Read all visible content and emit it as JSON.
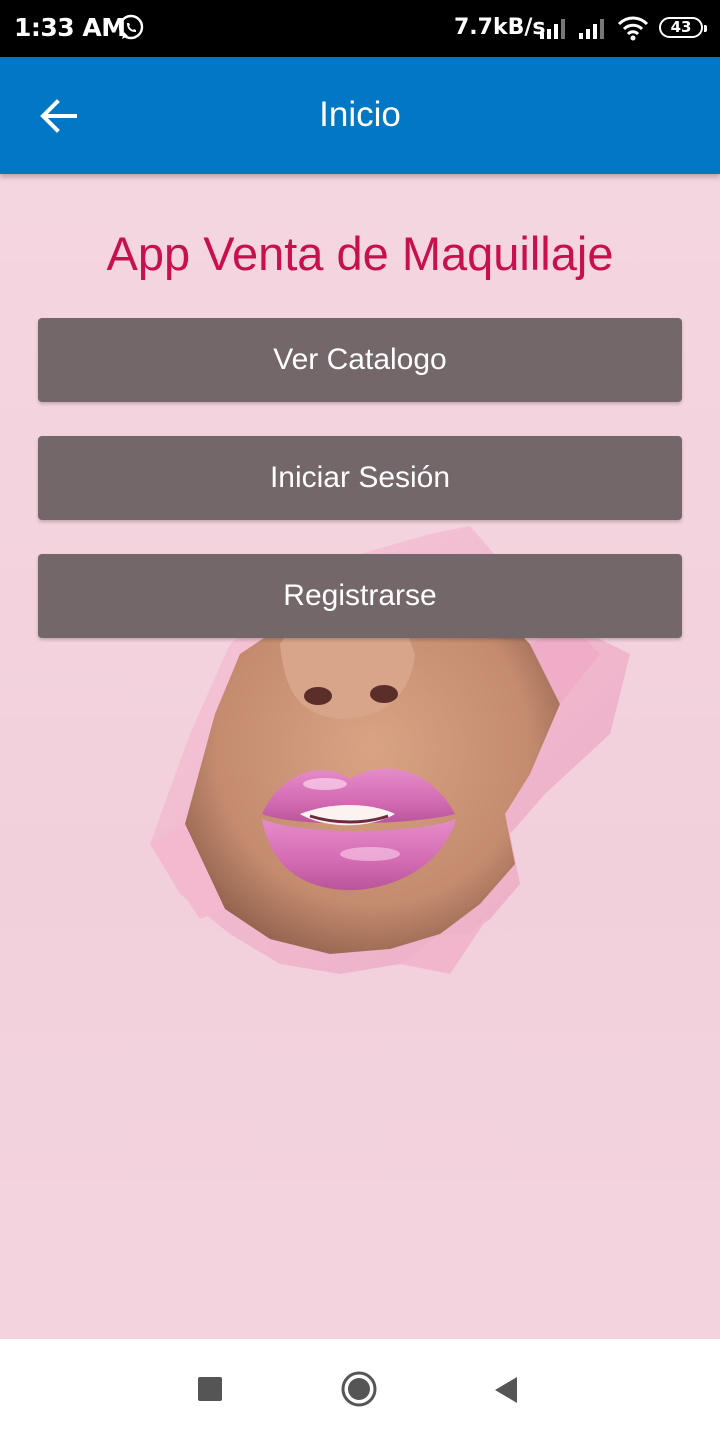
{
  "status_bar": {
    "time": "1:33 AM",
    "net_speed": "7.7kB/s",
    "battery": "43",
    "icons": [
      "whatsapp-icon",
      "signal-icon",
      "signal-icon",
      "wifi-icon",
      "battery-icon"
    ]
  },
  "app_bar": {
    "title": "Inicio",
    "back_icon": "arrow-left-icon"
  },
  "main": {
    "title": "App Venta de Maquillaje",
    "buttons": [
      "Ver Catalogo",
      "Iniciar Sesión",
      "Registrarse"
    ]
  },
  "nav_bar": {
    "icons": [
      "recents-square-icon",
      "home-circle-icon",
      "back-triangle-icon"
    ]
  },
  "colors": {
    "app_bar": "#0277c5",
    "title": "#c8104f",
    "button": "#736769",
    "background": "#f3d3dd"
  }
}
